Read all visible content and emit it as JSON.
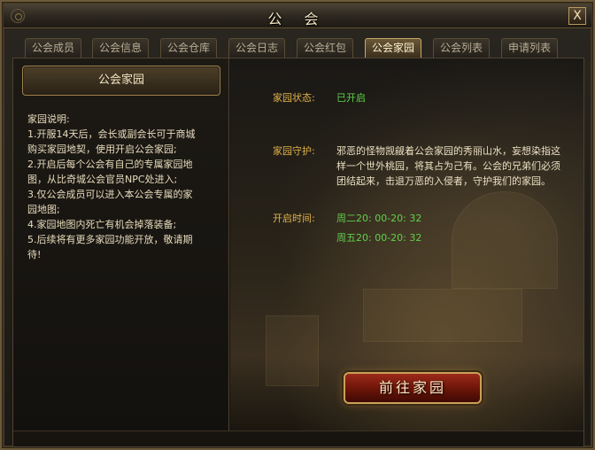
{
  "window": {
    "title": "公 会",
    "close_label": "X"
  },
  "tabs": [
    {
      "label": "公会成员",
      "active": false
    },
    {
      "label": "公会信息",
      "active": false
    },
    {
      "label": "公会仓库",
      "active": false
    },
    {
      "label": "公会日志",
      "active": false
    },
    {
      "label": "公会红包",
      "active": false
    },
    {
      "label": "公会家园",
      "active": true
    },
    {
      "label": "公会列表",
      "active": false
    },
    {
      "label": "申请列表",
      "active": false
    }
  ],
  "left": {
    "header": "公会家园",
    "desc_lines": [
      "家园说明:",
      "1.开服14天后，会长或副会长可于商城",
      "购买家园地契，使用开启公会家园;",
      "2.开启后每个公会有自己的专属家园地",
      "图，从比奇城公会官员NPC处进入;",
      "3.仅公会成员可以进入本公会专属的家",
      "园地图;",
      "4.家园地图内死亡有机会掉落装备;",
      "5.后续将有更多家园功能开放，敬请期",
      "待!"
    ]
  },
  "right": {
    "status_label": "家园状态:",
    "status_value": "已开启",
    "guard_label": "家园守护:",
    "guard_lines": [
      "邪恶的怪物觊觎着公会家园的秀丽山水，妄想染指这",
      "样一个世外桃园，将其占为己有。公会的兄弟们必须",
      "团结起来，击退万恶的入侵者，守护我们的家园。"
    ],
    "time_label": "开启时间:",
    "times": [
      "周二20: 00-20: 32",
      "周五20: 00-20: 32"
    ],
    "go_button": "前往家园"
  },
  "colors": {
    "label_gold": "#e0b14a",
    "value_green": "#5ed14a",
    "button_red": "#7a1a0c"
  }
}
